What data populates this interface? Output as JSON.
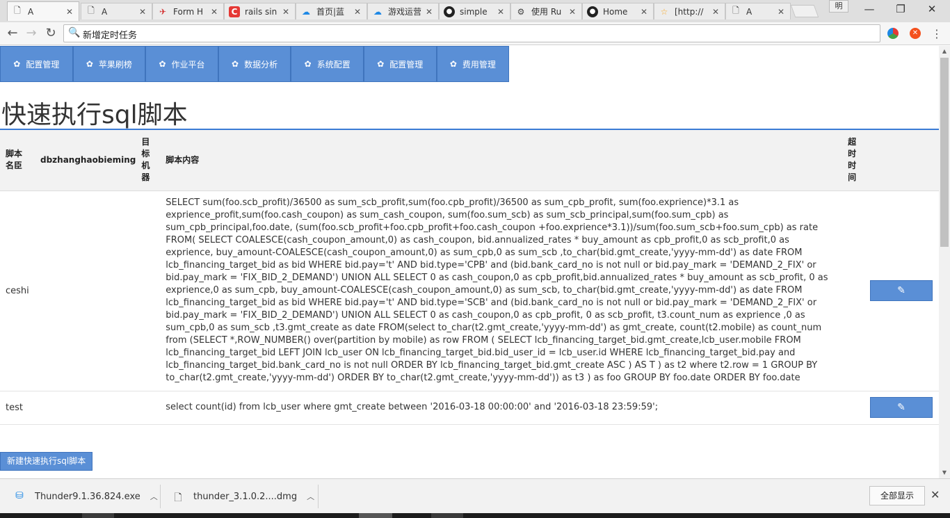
{
  "browser": {
    "tabs": [
      {
        "title": "A",
        "icon": "page-icon",
        "active": true
      },
      {
        "title": "A",
        "icon": "page-icon"
      },
      {
        "title": "Form H",
        "icon": "bird-icon"
      },
      {
        "title": "rails sin",
        "icon": "c-logo-icon"
      },
      {
        "title": "首页|蓝",
        "icon": "cloud-icon"
      },
      {
        "title": "游戏运营",
        "icon": "cloud-icon"
      },
      {
        "title": "simple",
        "icon": "github-icon"
      },
      {
        "title": "使用 Ru",
        "icon": "gear-icon"
      },
      {
        "title": "Home",
        "icon": "github-icon"
      },
      {
        "title": "[http://",
        "icon": "star-icon"
      },
      {
        "title": "A",
        "icon": "page-icon"
      }
    ],
    "profile_label": "明",
    "address": "新增定时任务"
  },
  "nav": {
    "items": [
      {
        "label": "配置管理"
      },
      {
        "label": "苹果刷榜"
      },
      {
        "label": "作业平台"
      },
      {
        "label": "数据分析"
      },
      {
        "label": "系统配置"
      },
      {
        "label": "配置管理"
      },
      {
        "label": "费用管理"
      }
    ]
  },
  "page": {
    "title": "快速执行sql脚本",
    "table": {
      "headers": {
        "name": "脚本名臣",
        "db": "dbzhanghaobieming",
        "target": "目标机器",
        "content": "脚本内容",
        "timeout": "超时时间"
      },
      "rows": [
        {
          "name": "ceshi",
          "db": "",
          "target": "",
          "content": "SELECT sum(foo.scb_profit)/36500 as sum_scb_profit,sum(foo.cpb_profit)/36500 as sum_cpb_profit, sum(foo.exprience)*3.1 as exprience_profit,sum(foo.cash_coupon) as sum_cash_coupon, sum(foo.sum_scb) as sum_scb_principal,sum(foo.sum_cpb) as sum_cpb_principal,foo.date, (sum(foo.scb_profit+foo.cpb_profit+foo.cash_coupon +foo.exprience*3.1))/sum(foo.sum_scb+foo.sum_cpb) as rate FROM( SELECT COALESCE(cash_coupon_amount,0) as cash_coupon, bid.annualized_rates * buy_amount as cpb_profit,0 as scb_profit,0 as exprience, buy_amount-COALESCE(cash_coupon_amount,0) as sum_cpb,0 as sum_scb ,to_char(bid.gmt_create,'yyyy-mm-dd') as date FROM lcb_financing_target_bid as bid WHERE bid.pay='t' AND bid.type='CPB' and (bid.bank_card_no is not null or bid.pay_mark = 'DEMAND_2_FIX' or bid.pay_mark = 'FIX_BID_2_DEMAND') UNION ALL SELECT 0 as cash_coupon,0 as cpb_profit,bid.annualized_rates * buy_amount as scb_profit, 0 as exprience,0 as sum_cpb, buy_amount-COALESCE(cash_coupon_amount,0) as sum_scb, to_char(bid.gmt_create,'yyyy-mm-dd') as date FROM lcb_financing_target_bid as bid WHERE bid.pay='t' AND bid.type='SCB' and (bid.bank_card_no is not null or bid.pay_mark = 'DEMAND_2_FIX' or bid.pay_mark = 'FIX_BID_2_DEMAND') UNION ALL SELECT 0 as cash_coupon,0 as cpb_profit, 0 as scb_profit, t3.count_num as exprience ,0 as sum_cpb,0 as sum_scb ,t3.gmt_create as date FROM(select to_char(t2.gmt_create,'yyyy-mm-dd') as gmt_create, count(t2.mobile) as count_num from (SELECT *,ROW_NUMBER() over(partition by mobile) as row FROM ( SELECT lcb_financing_target_bid.gmt_create,lcb_user.mobile FROM lcb_financing_target_bid LEFT JOIN lcb_user ON lcb_financing_target_bid.bid_user_id = lcb_user.id WHERE lcb_financing_target_bid.pay and lcb_financing_target_bid.bank_card_no is not null ORDER BY lcb_financing_target_bid.gmt_create ASC ) AS T ) as t2 where t2.row = 1 GROUP BY to_char(t2.gmt_create,'yyyy-mm-dd') ORDER BY to_char(t2.gmt_create,'yyyy-mm-dd')) as t3 ) as foo GROUP BY foo.date ORDER BY foo.date",
          "timeout": "",
          "edit_icon": "✎"
        },
        {
          "name": "test",
          "db": "",
          "target": "",
          "content": "select count(id) from lcb_user where gmt_create between '2016-03-18 00:00:00' and '2016-03-18 23:59:59';",
          "timeout": "",
          "edit_icon": "✎"
        }
      ]
    },
    "new_button": "新建快速执行sql脚本"
  },
  "downloads": {
    "items": [
      {
        "file": "Thunder9.1.36.824.exe",
        "icon": "installer-icon"
      },
      {
        "file": "thunder_3.1.0.2....dmg",
        "icon": "file-icon"
      }
    ],
    "show_all": "全部显示"
  },
  "colors": {
    "nav_blue": "#5a8fd6",
    "rule_blue": "#3a7bd5"
  }
}
